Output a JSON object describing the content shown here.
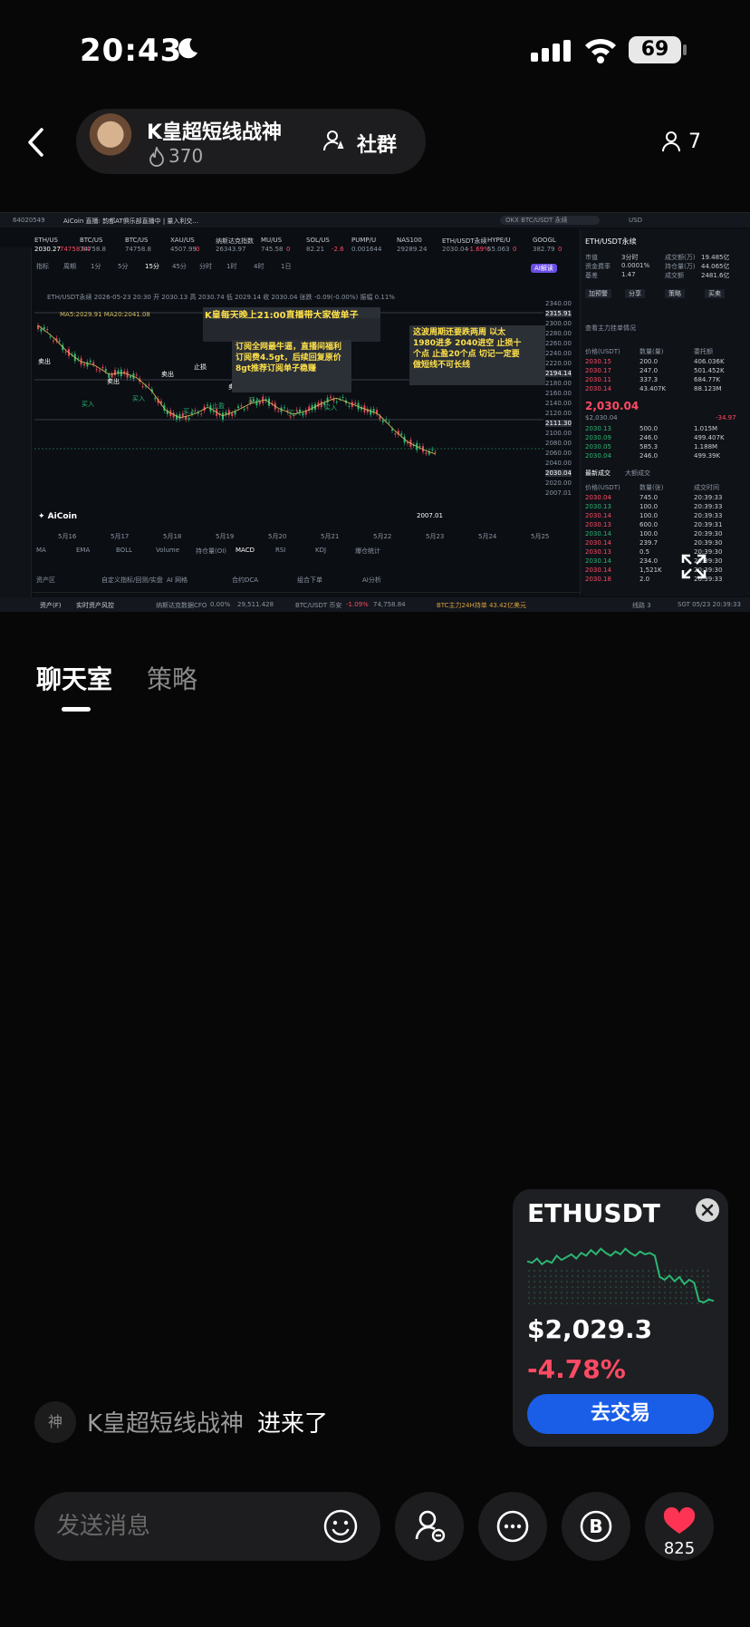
{
  "status_bar": {
    "time": "20:43",
    "battery": "69"
  },
  "header": {
    "anchor_name": "K皇超短线战神",
    "heat": "370",
    "community_label": "社群",
    "viewer_count": "7"
  },
  "screenshot": {
    "account_id": "64020549",
    "window_title": "AiCoin 直播: 韵都AT俱乐部直播中 | 量入利交...",
    "search_placeholder": "OKX BTC/USDT 永续",
    "currency": "USD",
    "watchlist": [
      {
        "symbol": "ETH/US",
        "price": "2030.27",
        "change": "74758.84"
      },
      {
        "symbol": "BTC/US",
        "price": "74758.8",
        "change": ""
      },
      {
        "symbol": "BTC/US",
        "price": "74758.8",
        "change": ""
      },
      {
        "symbol": "XAU/US",
        "price": "4507.99",
        "change": "0"
      },
      {
        "symbol": "纳斯达克指数",
        "price": "26343.97",
        "change": ""
      },
      {
        "symbol": "MU/US",
        "price": "745.58",
        "change": "0"
      },
      {
        "symbol": "SOL/US",
        "price": "82.21",
        "change": "-2.6"
      },
      {
        "symbol": "PUMP/U",
        "price": "0.001644",
        "change": ""
      },
      {
        "symbol": "NAS100",
        "price": "29289.24",
        "change": ""
      },
      {
        "symbol": "ETH/USDT永续",
        "price": "2030.04",
        "change": "-1.69%"
      },
      {
        "symbol": "HYPE/U",
        "price": "55.063",
        "change": "0"
      },
      {
        "symbol": "GOOGL",
        "price": "382.79",
        "change": "0"
      }
    ],
    "toolbar": [
      "指标",
      "周期",
      "1分",
      "5分",
      "15分",
      "45分",
      "分时",
      "1时",
      "4时",
      "1日"
    ],
    "chart_title": "ETH/USDT永续 2026-05-23 20:30 开 2030.13 高 2030.74 低 2029.14 收 2030.04 张跌 -0.09(-0.00%) 振幅 0.11%",
    "ma_line": "MA5:2029.91  MA20:2041.08",
    "annotations": {
      "banner": "K皇每天晚上21:00直播带大家做单子",
      "subscription": "订阅全网最牛逼，直播间福利订阅费4.5gt，后续回复原价8gt推荐订阅单子稳赚",
      "plan": "这波周期还要跌两周 以太1980进多 2040进空 止损十个点 止盈20个点 切记一定要做短线不可长线"
    },
    "signals": [
      "卖出",
      "买入",
      "卖出",
      "买入",
      "卖出",
      "买入",
      "止损",
      "止盈",
      "卖出",
      "买入",
      "卖出",
      "买入",
      "卖出",
      "买入"
    ],
    "price_axis": [
      "2340.00",
      "2315.91",
      "2300.00",
      "2280.00",
      "2260.00",
      "2240.00",
      "2220.00",
      "2194.14",
      "2180.00",
      "2160.00",
      "2140.00",
      "2120.00",
      "2111.30",
      "2100.00",
      "2080.00",
      "2060.00",
      "2040.00",
      "2030.04",
      "2020.00",
      "2007.01"
    ],
    "low_label": "2007.01",
    "dates": [
      "5月16",
      "5月17",
      "5月18",
      "5月19",
      "5月20",
      "5月21",
      "5月22",
      "5月23",
      "5月24",
      "5月25"
    ],
    "indicator_tabs": [
      "MA",
      "EMA",
      "BOLL",
      "Volume",
      "持仓量(OI)",
      "MACD",
      "RSI",
      "KDJ",
      "爆仓统计"
    ],
    "tools": [
      "资产区",
      "自定义指标/回测/实盘",
      "AI 网格",
      "合约DCA",
      "组合下单",
      "AI分析"
    ],
    "footer": {
      "assets": "资产(F)",
      "risk": "实时资产风控",
      "cfo": "纳斯达克数据CFO",
      "cfo_val": "0.00%",
      "idx_val": "29,511.428",
      "btc_label": "BTC/USDT 币安",
      "btc_chg": "-1.09%",
      "btc_price": "74,758.84",
      "flow": "BTC主力24H持单 43.42亿美元",
      "conn": "线路 3",
      "clock": "SGT 05/23 20:39:33"
    },
    "right_panel": {
      "symbol": "ETH/USDT永续",
      "stats": [
        [
          "市值",
          "3分时"
        ],
        [
          "成交额(万)",
          "19.485亿"
        ],
        [
          "资金费率",
          "0.0001%"
        ],
        [
          "持仓量(万)",
          "44.065亿"
        ],
        [
          "基差",
          "1.47"
        ],
        [
          "成交额",
          "2481.6亿"
        ]
      ],
      "actions": [
        "加预警",
        "分享",
        "策略",
        "买卖"
      ],
      "depth_link": "查看主力挂单情况",
      "depth_cols": [
        "价格(USDT)",
        "数量(量)",
        "委托额"
      ],
      "asks": [
        [
          "2030.15",
          "200.0",
          "406.036K"
        ],
        [
          "2030.17",
          "247.0",
          "501.452K"
        ],
        [
          "2030.11",
          "337.3",
          "684.77K"
        ],
        [
          "2030.14",
          "43.407K",
          "88.123M"
        ]
      ],
      "last_price": "2,030.04",
      "last_sub": "$2,030.04",
      "last_chg": "-34.97",
      "bids": [
        [
          "2030.13",
          "500.0",
          "1.015M"
        ],
        [
          "2030.09",
          "246.0",
          "499.407K"
        ],
        [
          "2030.05",
          "585.3",
          "1.188M"
        ],
        [
          "2030.04",
          "246.0",
          "499.39K"
        ]
      ],
      "trade_tabs": [
        "最新成交",
        "大额成交"
      ],
      "trade_cols": [
        "价格(USDT)",
        "数量(张)",
        "成交时间"
      ],
      "trades": [
        [
          "2030.04",
          "745.0",
          "20:39:33"
        ],
        [
          "2030.13",
          "100.0",
          "20:39:33"
        ],
        [
          "2030.14",
          "100.0",
          "20:39:33"
        ],
        [
          "2030.13",
          "600.0",
          "20:39:31"
        ],
        [
          "2030.14",
          "100.0",
          "20:39:30"
        ],
        [
          "2030.14",
          "239.7",
          "20:39:30"
        ],
        [
          "2030.13",
          "0.5",
          "20:39:30"
        ],
        [
          "2030.14",
          "234.0",
          "20:39:30"
        ],
        [
          "2030.14",
          "1,521K",
          "20:39:30"
        ],
        [
          "2030.18",
          "2.0",
          "20:39:33"
        ]
      ]
    }
  },
  "tabs": {
    "chat": "聊天室",
    "strategy": "策略"
  },
  "ticker_card": {
    "symbol": "ETHUSDT",
    "price": "$2,029.3",
    "change": "-4.78%",
    "button": "去交易",
    "sparkline": [
      0.62,
      0.6,
      0.66,
      0.58,
      0.63,
      0.6,
      0.7,
      0.64,
      0.68,
      0.72,
      0.66,
      0.74,
      0.7,
      0.78,
      0.72,
      0.8,
      0.74,
      0.7,
      0.76,
      0.72,
      0.8,
      0.74,
      0.7,
      0.76,
      0.72,
      0.74,
      0.7,
      0.4,
      0.36,
      0.42,
      0.34,
      0.4,
      0.3,
      0.36,
      0.32,
      0.06,
      0.04,
      0.08,
      0.06
    ]
  },
  "chat": {
    "join_avatar": "神",
    "join_name": "K皇超短线战神",
    "join_action": "进来了"
  },
  "bottom_bar": {
    "input_placeholder": "发送消息",
    "likes": "825"
  },
  "colors": {
    "accent_blue": "#1a5ee8",
    "down_red": "#ff4a64",
    "up_green": "#2bb673",
    "chart_bg": "#0b0e13"
  }
}
